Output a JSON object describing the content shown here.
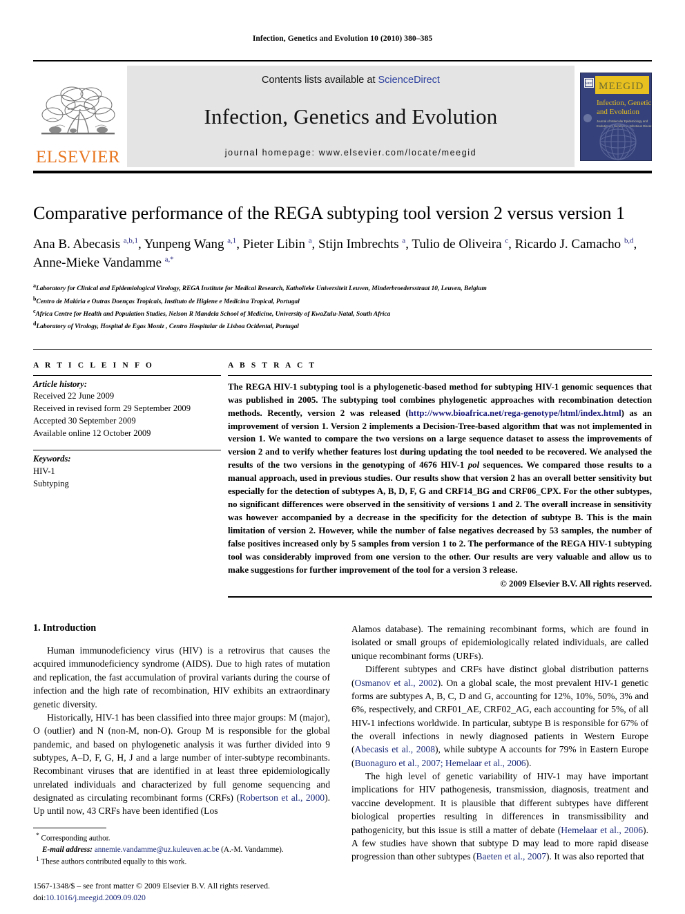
{
  "running_head": "Infection, Genetics and Evolution 10 (2010) 380–385",
  "masthead": {
    "publisher_logo_text": "ELSEVIER",
    "contents_line_prefix": "Contents lists available at ",
    "contents_link": "ScienceDirect",
    "journal_title": "Infection, Genetics and Evolution",
    "homepage_line": "journal homepage: www.elsevier.com/locate/meegid",
    "cover": {
      "banner_text": "MEEGID",
      "line1": "Infection, Genetics",
      "line2": "and Evolution",
      "subline1": "Journal of Molecular Epidemiology and",
      "subline2": "Evolutionary Genetics in Infectious Diseases",
      "banner_color": "#e8c01f",
      "background_color": "#35417a"
    }
  },
  "article": {
    "title": "Comparative performance of the REGA subtyping tool version 2 versus version 1",
    "authors_html": "Ana B. Abecasis <sup>a,b,1</sup>, Yunpeng Wang <sup>a,1</sup>, Pieter Libin <sup>a</sup>, Stijn Imbrechts <sup>a</sup>, Tulio de Oliveira <sup>c</sup>, Ricardo J. Camacho <sup>b,d</sup>, Anne-Mieke Vandamme <sup>a,*</sup>",
    "affiliations": [
      {
        "marker": "a",
        "text": "Laboratory for Clinical and Epidemiological Virology, REGA Institute for Medical Research, Katholieke Universiteit Leuven, Minderbroedersstraat 10, Leuven, Belgium"
      },
      {
        "marker": "b",
        "text": "Centro de Malária e Outras Doenças Tropicais, Instituto de Higiene e Medicina Tropical, Portugal"
      },
      {
        "marker": "c",
        "text": "Africa Centre for Health and Population Studies, Nelson R Mandela School of Medicine, University of KwaZulu-Natal, South Africa"
      },
      {
        "marker": "d",
        "text": "Laboratory of Virology, Hospital de Egas Moniz , Centro Hospitalar de Lisboa Ocidental, Portugal"
      }
    ]
  },
  "article_info": {
    "label": "A R T I C L E   I N F O",
    "history_label": "Article history:",
    "history": [
      "Received 22 June 2009",
      "Received in revised form 29 September 2009",
      "Accepted 30 September 2009",
      "Available online 12 October 2009"
    ],
    "keywords_label": "Keywords:",
    "keywords": [
      "HIV-1",
      "Subtyping"
    ]
  },
  "abstract": {
    "label": "A B S T R A C T",
    "part1": "The REGA HIV-1 subtyping tool is a phylogenetic-based method for subtyping HIV-1 genomic sequences that was published in 2005. The subtyping tool combines phylogenetic approaches with recombination detection methods. Recently, version 2 was released (",
    "url": "http://www.bioafrica.net/rega-genotype/html/index.html",
    "part2": ") as an improvement of version 1. Version 2 implements a Decision-Tree-based algorithm that was not implemented in version 1. We wanted to compare the two versions on a large sequence dataset to assess the improvements of version 2 and to verify whether features lost during updating the tool needed to be recovered. We analysed the results of the two versions in the genotyping of 4676 HIV-1 ",
    "italic_term": "pol",
    "part3": " sequences. We compared those results to a manual approach, used in previous studies. Our results show that version 2 has an overall better sensitivity but especially for the detection of subtypes A, B, D, F, G and CRF14_BG and CRF06_CPX. For the other subtypes, no significant differences were observed in the sensitivity of versions 1 and 2. The overall increase in sensitivity was however accompanied by a decrease in the specificity for the detection of subtype B. This is the main limitation of version 2. However, while the number of false negatives decreased by 53 samples, the number of false positives increased only by 5 samples from version 1 to 2. The performance of the REGA HIV-1 subtyping tool was considerably improved from one version to the other. Our results are very valuable and allow us to make suggestions for further improvement of the tool for a version 3 release.",
    "copyright": "© 2009 Elsevier B.V. All rights reserved."
  },
  "body": {
    "section_heading": "1. Introduction",
    "left": {
      "p1": "Human immunodeficiency virus (HIV) is a retrovirus that causes the acquired immunodeficiency syndrome (AIDS). Due to high rates of mutation and replication, the fast accumulation of proviral variants during the course of infection and the high rate of recombination, HIV exhibits an extraordinary genetic diversity.",
      "p2a": "Historically, HIV-1 has been classified into three major groups: M (major), O (outlier) and N (non-M, non-O). Group M is responsible for the global pandemic, and based on phylogenetic analysis it was further divided into 9 subtypes, A–D, F, G, H, J and a large number of inter-subtype recombinants. Recombinant viruses that are identified in at least three epidemiologically unrelated individuals and characterized by full genome sequencing and designated as circulating recombinant forms (CRFs) (",
      "p2ref": "Robertson et al., 2000",
      "p2b": "). Up until now, 43 CRFs have been identified (Los"
    },
    "right": {
      "p1": "Alamos database). The remaining recombinant forms, which are found in isolated or small groups of epidemiologically related individuals, are called unique recombinant forms (URFs).",
      "p2a": "Different subtypes and CRFs have distinct global distribution patterns (",
      "p2ref1": "Osmanov et al., 2002",
      "p2b": "). On a global scale, the most prevalent HIV-1 genetic forms are subtypes A, B, C, D and G, accounting for 12%, 10%, 50%, 3% and 6%, respectively, and CRF01_AE, CRF02_AG, each accounting for 5%, of all HIV-1 infections worldwide. In particular, subtype B is responsible for 67% of the overall infections in newly diagnosed patients in Western Europe (",
      "p2ref2": "Abecasis et al., 2008",
      "p2c": "), while subtype A accounts for 79% in Eastern Europe (",
      "p2ref3": "Buonaguro et al., 2007; Hemelaar et al., 2006",
      "p2d": ").",
      "p3a": "The high level of genetic variability of HIV-1 may have important implications for HIV pathogenesis, transmission, diagnosis, treatment and vaccine development. It is plausible that different subtypes have different biological properties resulting in differences in transmissibility and pathogenicity, but this issue is still a matter of debate (",
      "p3ref1": "Hemelaar et al., 2006",
      "p3b": "). A few studies have shown that subtype D may lead to more rapid disease progression than other subtypes (",
      "p3ref2": "Baeten et al., 2007",
      "p3c": "). It was also reported that"
    }
  },
  "footnotes": {
    "corresponding_marker": "*",
    "corresponding": "Corresponding author.",
    "email_label": "E-mail address:",
    "email": "annemie.vandamme@uz.kuleuven.ac.be",
    "email_owner": "(A.-M. Vandamme).",
    "note_marker": "1",
    "note": "These authors contributed equally to this work.",
    "imprint": "1567-1348/$ – see front matter © 2009 Elsevier B.V. All rights reserved.",
    "doi_label": "doi:",
    "doi": "10.1016/j.meegid.2009.09.020"
  }
}
